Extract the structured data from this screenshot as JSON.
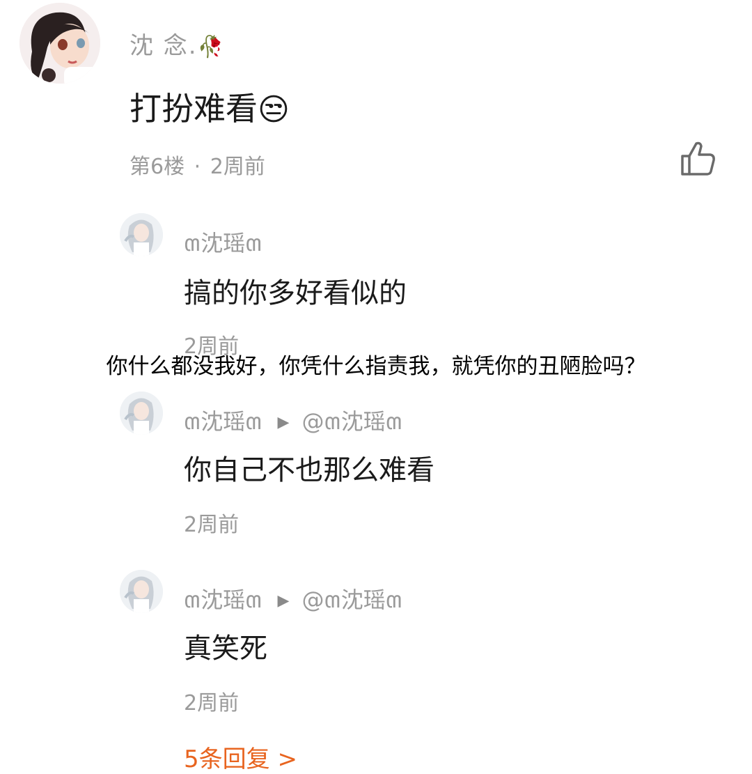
{
  "main_comment": {
    "author": "沈 念.",
    "flower_emoji": "🥀",
    "text": "打扮难看",
    "emoji": "😒",
    "floor": "第6楼",
    "dot": "·",
    "time": "2周前"
  },
  "replies": [
    {
      "author": "ຓ沈瑶ຓ",
      "reply_to": "",
      "text": "搞的你多好看似的",
      "time": "2周前"
    },
    {
      "author": "ຓ沈瑶ຓ",
      "arrow": "▶",
      "reply_to": "@ຓ沈瑶ຓ",
      "text": "你自己不也那么难看",
      "time": "2周前"
    },
    {
      "author": "ຓ沈瑶ຓ",
      "arrow": "▶",
      "reply_to": "@ຓ沈瑶ຓ",
      "text": "真笑死",
      "time": "2周前"
    }
  ],
  "overlay_caption": "你什么都没我好，你凭什么指责我，就凭你的丑陋脸吗？",
  "more_replies": "5条回复 >",
  "colors": {
    "text_primary": "#1a1a1a",
    "text_secondary": "#9a9a9a",
    "accent_orange": "#e8641f"
  }
}
